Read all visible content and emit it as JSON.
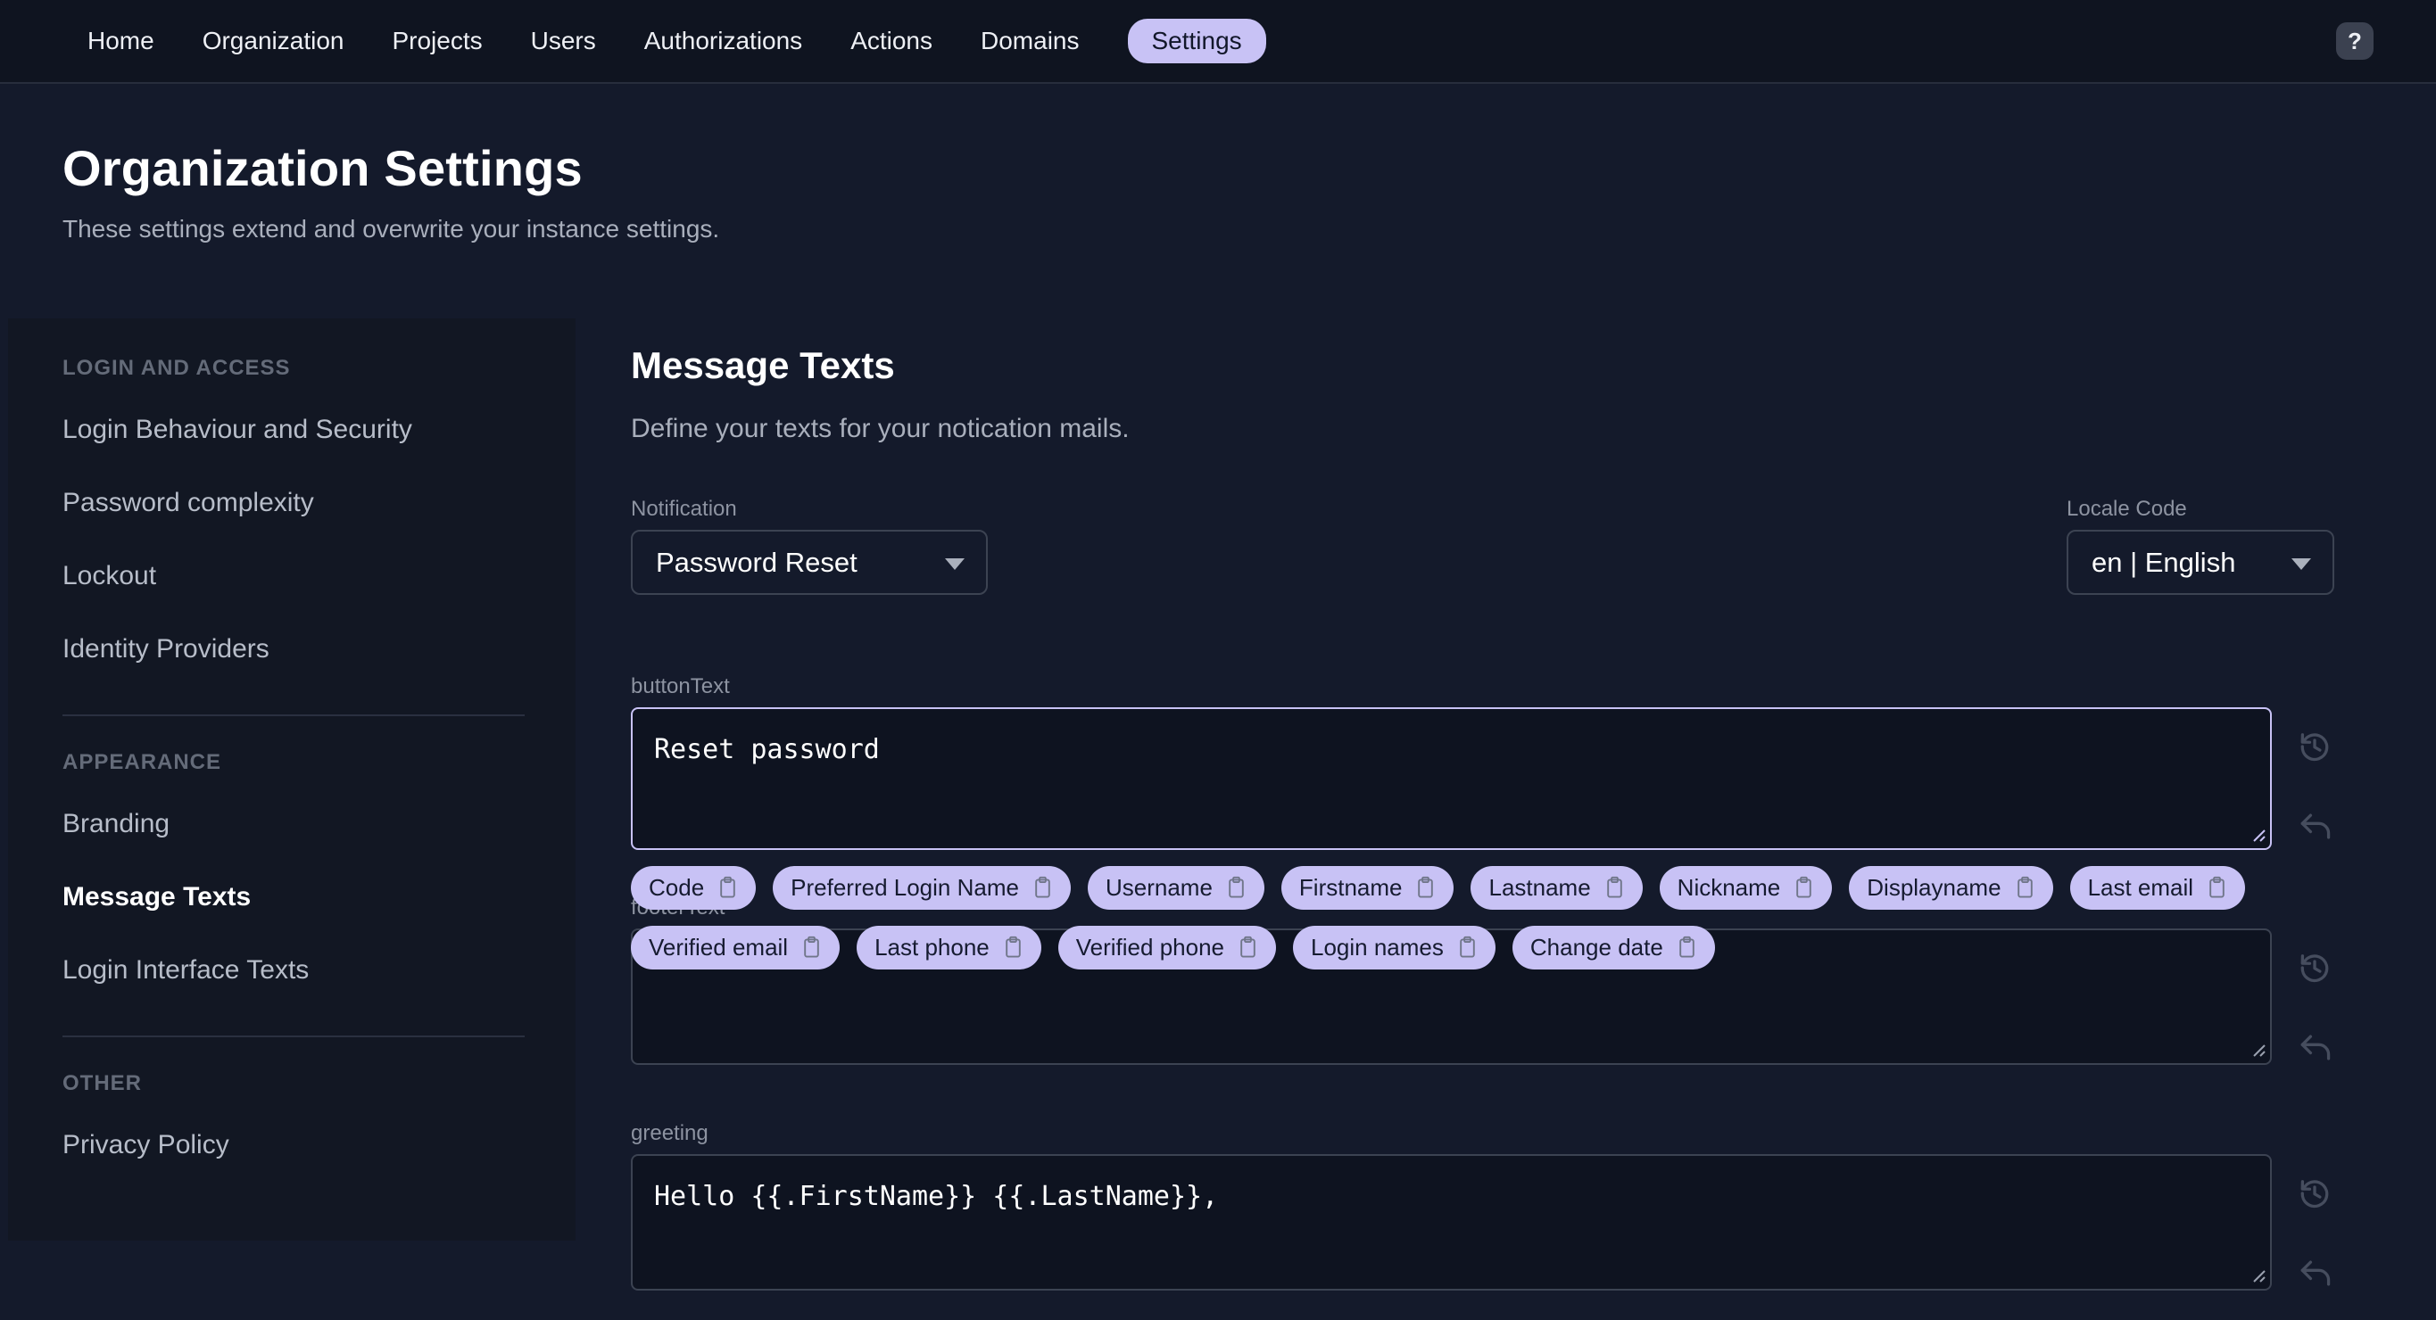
{
  "nav": {
    "items": [
      "Home",
      "Organization",
      "Projects",
      "Users",
      "Authorizations",
      "Actions",
      "Domains",
      "Settings"
    ],
    "active_item": "Settings",
    "help_label": "?"
  },
  "header": {
    "title": "Organization Settings",
    "subtitle": "These settings extend and overwrite your instance settings."
  },
  "sidebar": {
    "sections": [
      {
        "title": "LOGIN AND ACCESS",
        "items": [
          "Login Behaviour and Security",
          "Password complexity",
          "Lockout",
          "Identity Providers"
        ]
      },
      {
        "title": "APPEARANCE",
        "items": [
          "Branding",
          "Message Texts",
          "Login Interface Texts"
        ]
      },
      {
        "title": "OTHER",
        "items": [
          "Privacy Policy"
        ]
      }
    ],
    "active_item": "Message Texts"
  },
  "main": {
    "title": "Message Texts",
    "subtitle": "Define your texts for your notication mails.",
    "notification": {
      "label": "Notification",
      "value": "Password Reset"
    },
    "locale": {
      "label": "Locale Code",
      "value": "en | English"
    },
    "fields": [
      {
        "label": "buttonText",
        "value": "Reset password"
      },
      {
        "label": "footerText",
        "value": ""
      },
      {
        "label": "greeting",
        "value": "Hello {{.FirstName}} {{.LastName}},"
      }
    ],
    "chips": {
      "row1": [
        "Code",
        "Preferred Login Name",
        "Username",
        "Firstname",
        "Lastname",
        "Nickname",
        "Displayname",
        "Last email"
      ],
      "row2": [
        "Verified email",
        "Last phone",
        "Verified phone",
        "Login names",
        "Change date"
      ]
    }
  },
  "colors": {
    "accent": "#c8c2f5",
    "page_background": "#141a2b",
    "nav_background": "#0f1420",
    "sidebar_background": "#121723",
    "textarea_background": "#0e1320",
    "border": "#3c4352"
  }
}
